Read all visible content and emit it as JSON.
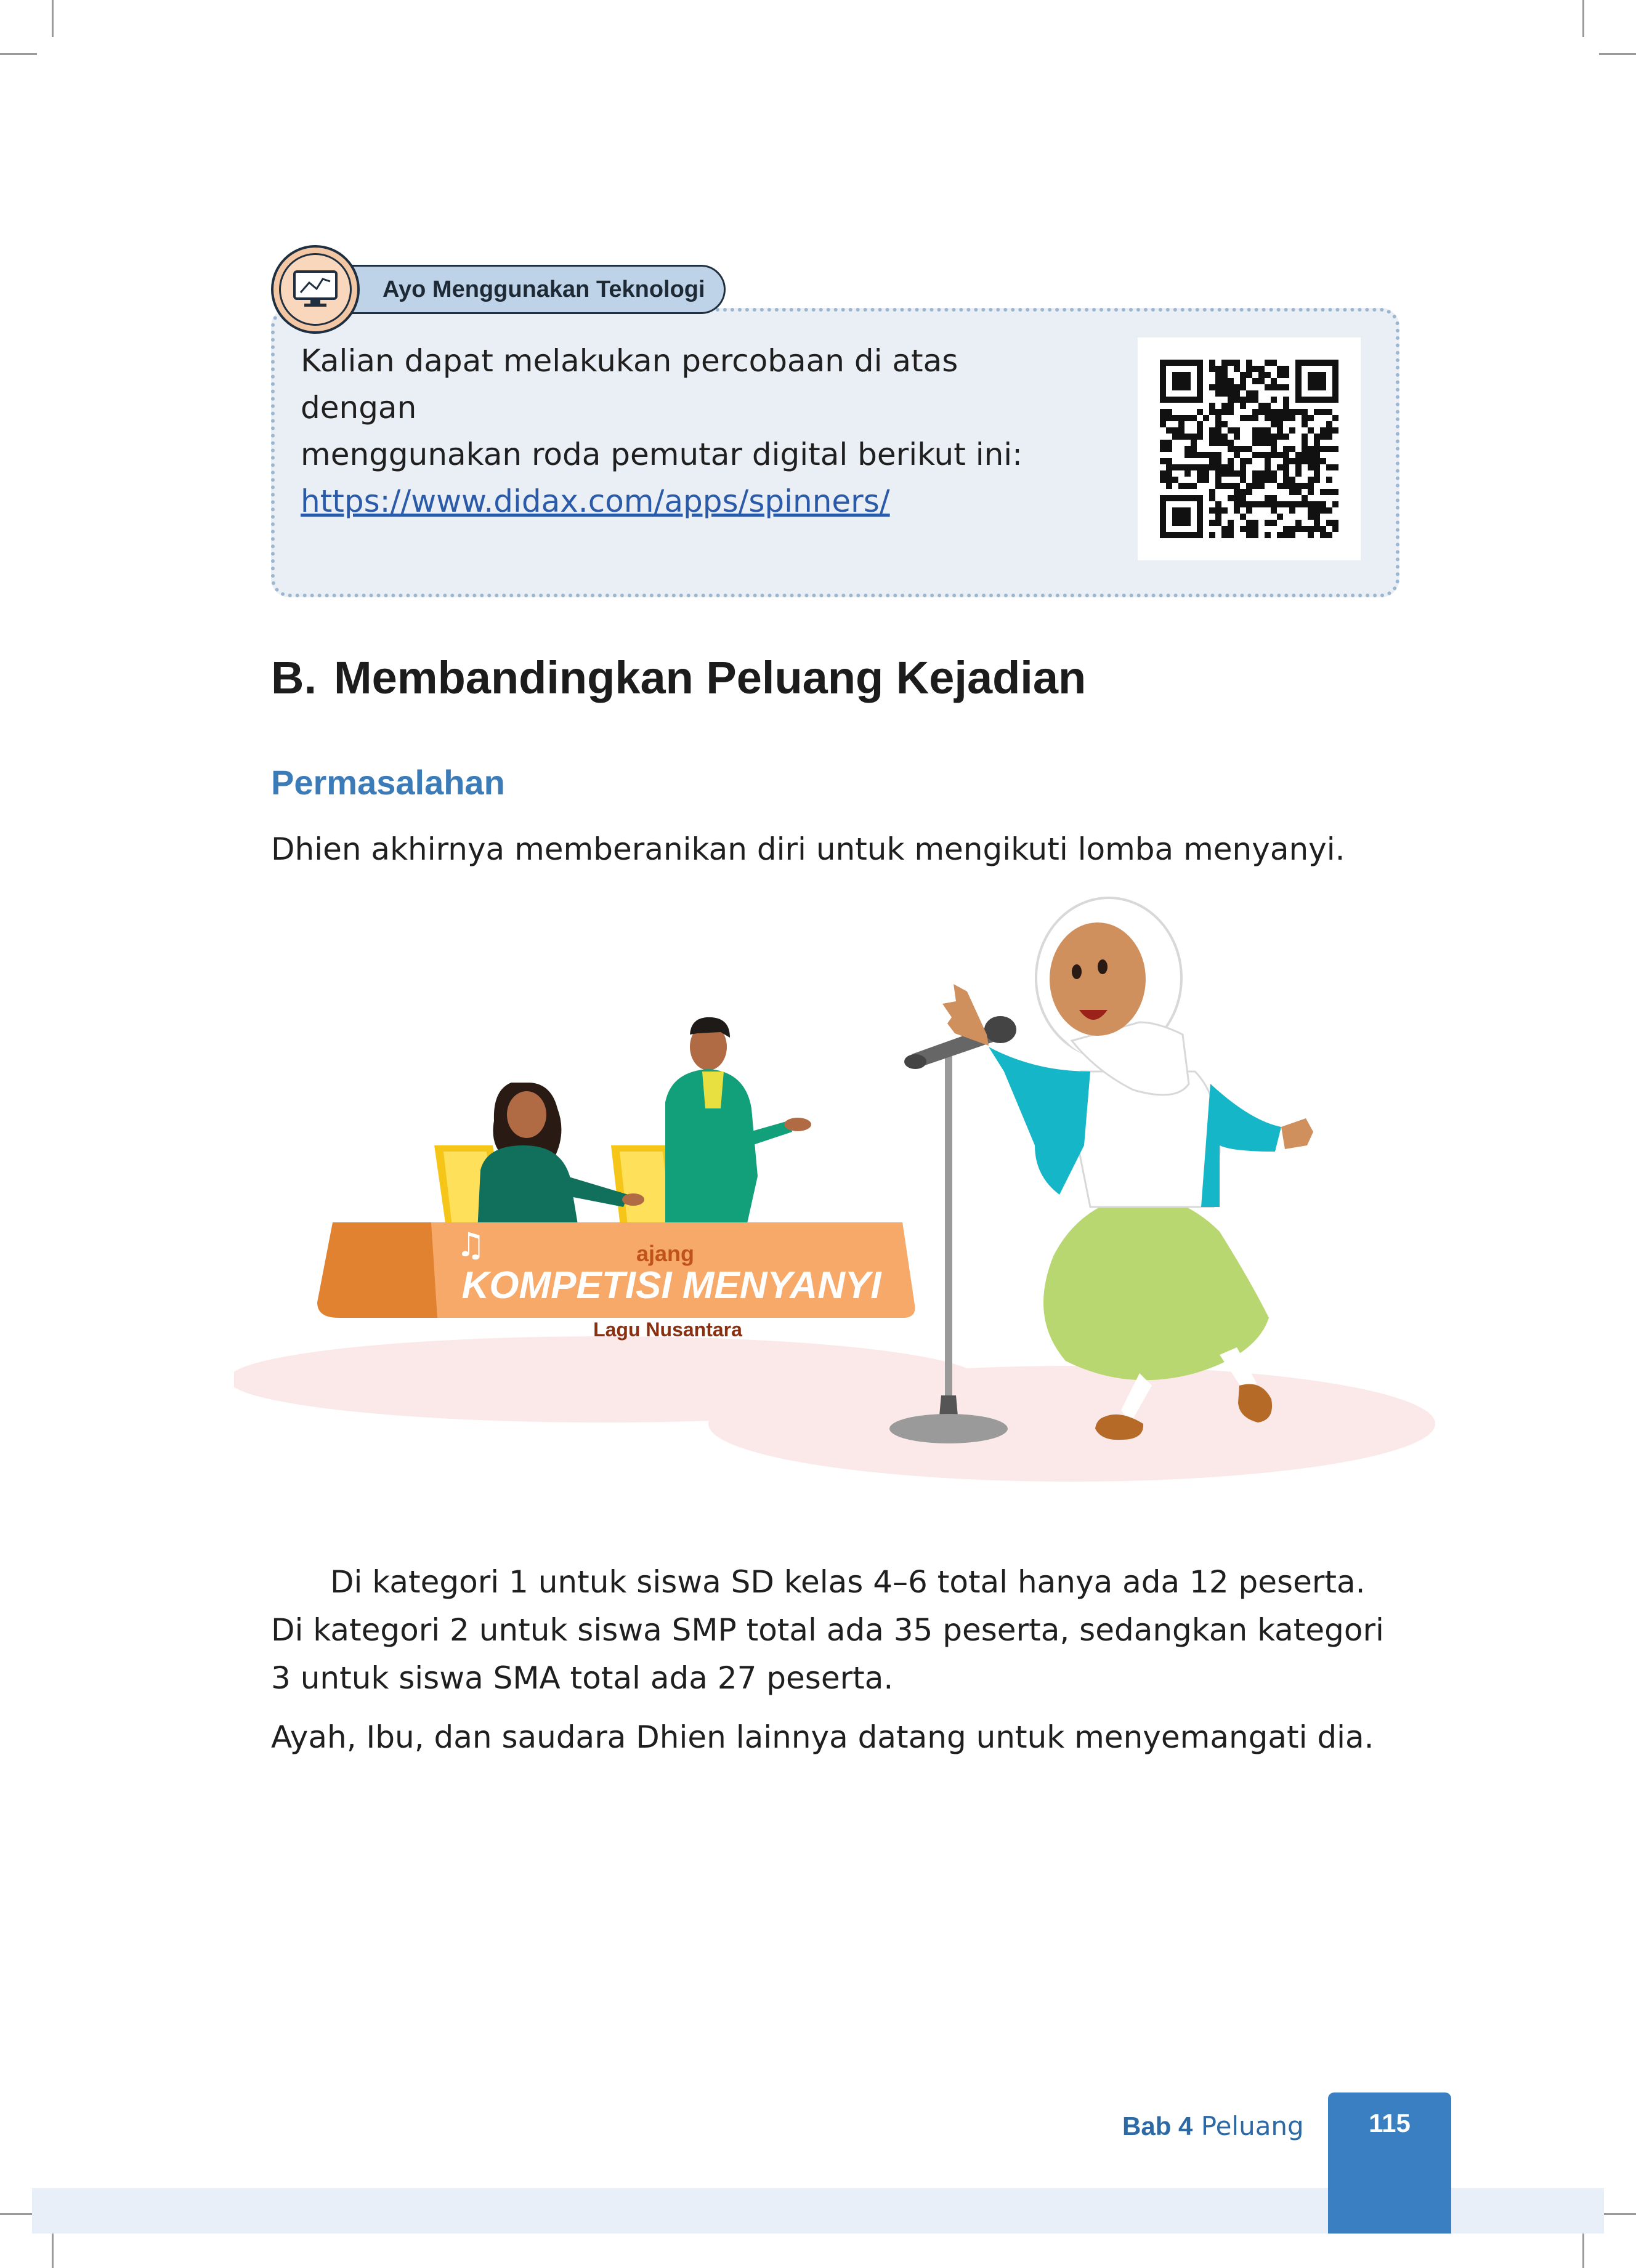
{
  "tech_box": {
    "tab_label": "Ayo Menggunakan Teknologi",
    "text_line1": "Kalian dapat melakukan percobaan di atas dengan",
    "text_line2": "menggunakan roda pemutar digital berikut ini:",
    "link": "https://www.didax.com/apps/spinners/",
    "icon": "computer-chart-icon"
  },
  "section": {
    "number": "B.",
    "title": "Membandingkan Peluang Kejadian"
  },
  "subsection": "Permasalahan",
  "paragraph1": "Dhien akhirnya memberanikan diri untuk mengikuti lomba menyanyi.",
  "illustration": {
    "banner_small": "ajang",
    "banner_title": "KOMPETISI MENYANYI",
    "banner_sub": "Lagu Nusantara"
  },
  "paragraph2": "Di kategori 1 untuk siswa SD kelas 4–6 total hanya ada 12 peserta. Di kategori 2 untuk siswa SMP total ada 35 peserta, sedangkan kategori 3 untuk siswa SMA total ada 27 peserta.",
  "paragraph3": "Ayah, Ibu, dan saudara Dhien lainnya datang untuk menyemangati dia.",
  "footer": {
    "chapter": "Bab 4",
    "chapter_name": "Peluang",
    "page_number": "115"
  },
  "colors": {
    "accent_blue": "#3a7bb8",
    "tab_blue": "#bfd3e8",
    "box_bg": "#e9eff5",
    "banner_orange": "#f7a96a"
  }
}
